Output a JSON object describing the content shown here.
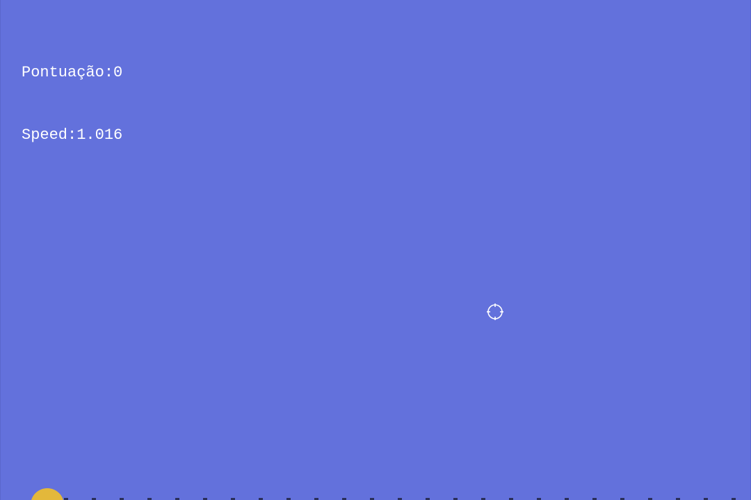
{
  "hud": {
    "score_label": "Pontuação:",
    "score_value": "0",
    "speed_label": "Speed:",
    "speed_value": "1.016"
  },
  "colors": {
    "background": "#6371dc",
    "text": "#ffffff",
    "player": "#e3b83b",
    "ground": "#2a2f5a",
    "crosshair": "#ffffff"
  },
  "icons": {
    "cursor": "crosshair-icon"
  }
}
